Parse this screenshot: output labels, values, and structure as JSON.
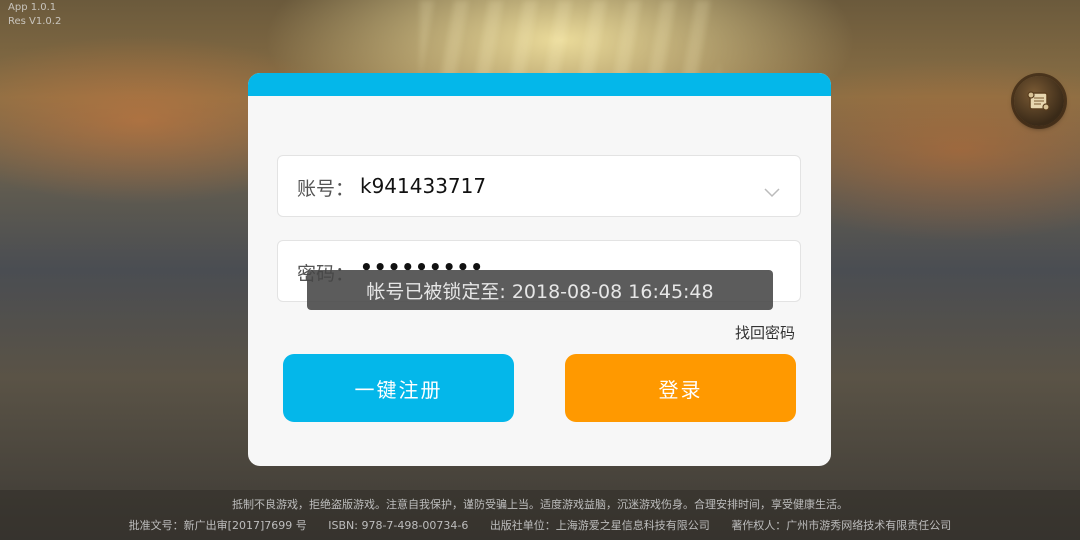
{
  "app": {
    "version_app": "App 1.0.1",
    "version_res": "Res V1.0.2"
  },
  "login": {
    "account_label": "账号：",
    "account_value": "k941433717",
    "password_label": "密码：",
    "password_value": "•••••••••",
    "forgot_password": "找回密码",
    "register_button": "一键注册",
    "login_button": "登录"
  },
  "toast": {
    "message": "帐号已被锁定至: 2018-08-08 16:45:48"
  },
  "footer": {
    "notice": "抵制不良游戏，拒绝盗版游戏。注意自我保护，谨防受骗上当。适度游戏益脑，沉迷游戏伤身。合理安排时间，享受健康生活。",
    "approval": "批准文号：新广出审[2017]7699 号",
    "isbn": "ISBN: 978-7-498-00734-6",
    "publisher": "出版社单位：上海游爱之星信息科技有限公司",
    "copyright": "著作权人：广州市游秀网络技术有限责任公司"
  },
  "icons": {
    "top_right": "scroll-icon",
    "dropdown": "chevron-down-icon"
  },
  "colors": {
    "header": "#04b7ea",
    "register_button": "#04b7ea",
    "login_button": "#ff9900"
  }
}
